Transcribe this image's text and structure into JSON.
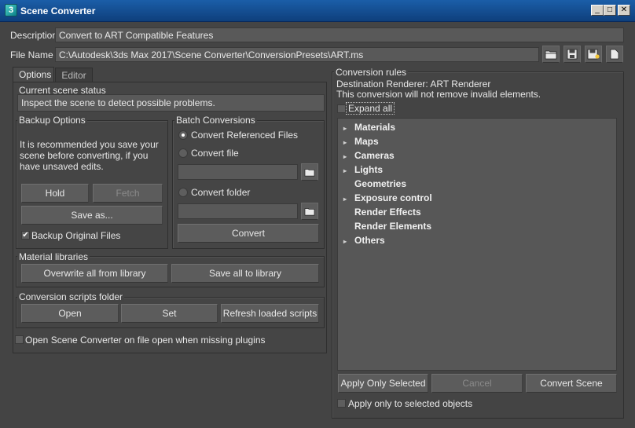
{
  "window": {
    "title": "Scene Converter"
  },
  "header": {
    "description_label": "Description",
    "description_value": "Convert to ART Compatible Features",
    "filename_label": "File Name",
    "filename_value": "C:\\Autodesk\\3ds Max 2017\\Scene Converter\\ConversionPresets\\ART.ms"
  },
  "tabs": [
    {
      "label": "Options"
    },
    {
      "label": "Editor"
    }
  ],
  "scene_status": {
    "title": "Current scene status",
    "message": "Inspect the scene to detect possible problems."
  },
  "backup": {
    "title": "Backup Options",
    "text": "It is recommended you save your scene before converting, if you have unsaved edits.",
    "hold": "Hold",
    "fetch": "Fetch",
    "save_as": "Save as...",
    "backup_original": "Backup Original Files",
    "backup_original_checked": true
  },
  "batch": {
    "title": "Batch Conversions",
    "options": [
      {
        "label": "Convert Referenced Files",
        "selected": true
      },
      {
        "label": "Convert file",
        "selected": false
      },
      {
        "label": "Convert folder",
        "selected": false
      }
    ],
    "convert": "Convert"
  },
  "material_libraries": {
    "title": "Material libraries",
    "overwrite": "Overwrite all from library",
    "save_all": "Save all to library"
  },
  "scripts": {
    "title": "Conversion scripts folder",
    "open": "Open",
    "set": "Set",
    "refresh": "Refresh loaded scripts"
  },
  "open_on_missing": "Open Scene Converter on file open when missing plugins",
  "rules": {
    "title": "Conversion rules",
    "destination": "Destination Renderer: ART Renderer",
    "note": "This conversion will not remove invalid elements.",
    "expand_all": "Expand all",
    "items": [
      {
        "label": "Materials",
        "expandable": true
      },
      {
        "label": "Maps",
        "expandable": true
      },
      {
        "label": "Cameras",
        "expandable": true
      },
      {
        "label": "Lights",
        "expandable": true
      },
      {
        "label": "Geometries",
        "expandable": false
      },
      {
        "label": "Exposure control",
        "expandable": true
      },
      {
        "label": "Render Effects",
        "expandable": false
      },
      {
        "label": "Render Elements",
        "expandable": false
      },
      {
        "label": "Others",
        "expandable": true
      }
    ],
    "apply_selected": "Apply Only Selected",
    "cancel": "Cancel",
    "convert_scene": "Convert Scene",
    "apply_only_selected_objects": "Apply only to selected objects"
  }
}
